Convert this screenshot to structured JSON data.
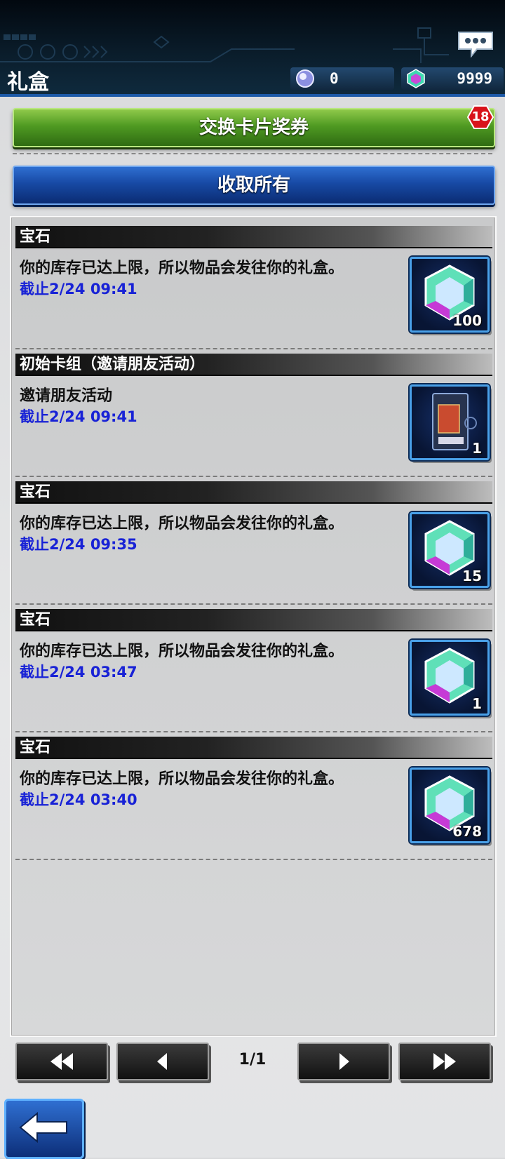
{
  "header": {
    "title": "礼盒",
    "orb_count": "0",
    "gem_count": "9999"
  },
  "buttons": {
    "exchange_label": "交换卡片奖券",
    "exchange_badge": "18",
    "collect_all_label": "收取所有"
  },
  "items": [
    {
      "category": "宝石",
      "desc": "你的库存已达上限，所以物品会发往你的礼盒。",
      "deadline": "截止2/24 09:41",
      "icon": "gem-icon",
      "count": "100"
    },
    {
      "category": "初始卡组（邀请朋友活动）",
      "desc": "邀请朋友活动",
      "deadline": "截止2/24 09:41",
      "icon": "deck-box-icon",
      "count": "1"
    },
    {
      "category": "宝石",
      "desc": "你的库存已达上限，所以物品会发往你的礼盒。",
      "deadline": "截止2/24 09:35",
      "icon": "gem-icon",
      "count": "15"
    },
    {
      "category": "宝石",
      "desc": "你的库存已达上限，所以物品会发往你的礼盒。",
      "deadline": "截止2/24 03:47",
      "icon": "gem-icon",
      "count": "1"
    },
    {
      "category": "宝石",
      "desc": "你的库存已达上限，所以物品会发往你的礼盒。",
      "deadline": "截止2/24 03:40",
      "icon": "gem-icon",
      "count": "678"
    }
  ],
  "pagination": {
    "indicator": "1/1"
  },
  "colors": {
    "deadline_text": "#1822d6",
    "accent_blue": "#1749a4",
    "accent_green": "#4f9a22",
    "badge_red": "#d8131b"
  }
}
